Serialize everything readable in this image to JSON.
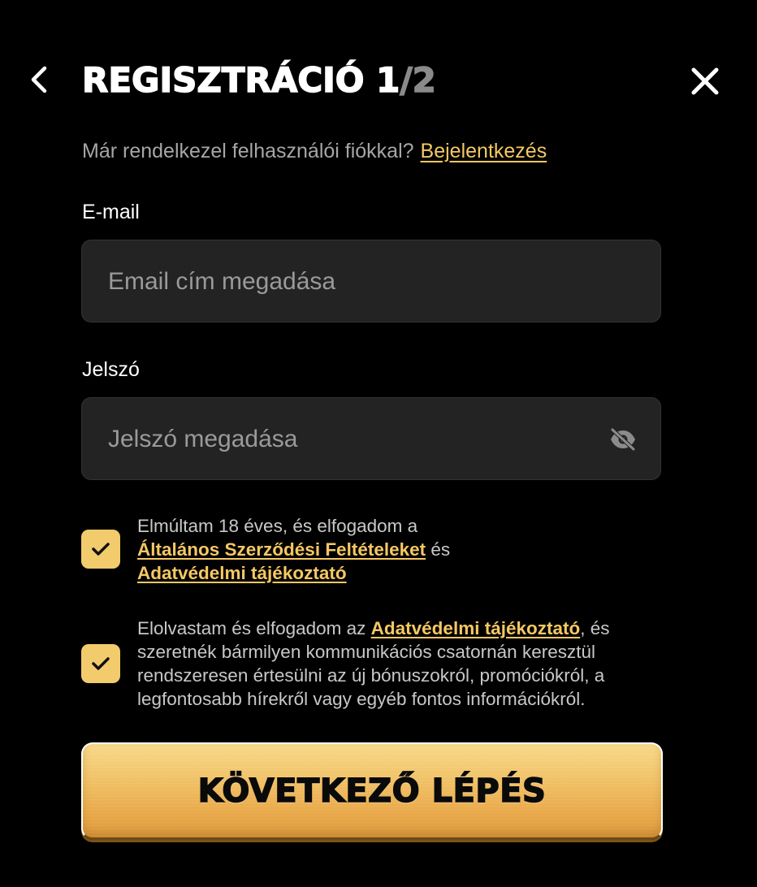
{
  "header": {
    "title_main": "REGISZTRÁCIÓ 1",
    "title_total": "/2",
    "back_icon": "chevron-left-icon",
    "close_icon": "close-icon"
  },
  "login_prompt": {
    "text": "Már rendelkezel felhasználói fiókkal?",
    "link": "Bejelentkezés"
  },
  "email": {
    "label": "E-mail",
    "placeholder": "Email cím megadása",
    "value": ""
  },
  "password": {
    "label": "Jelszó",
    "placeholder": "Jelszó megadása",
    "value": "",
    "toggle_icon": "eye-off-icon"
  },
  "consents": [
    {
      "checked": true,
      "text_1": "Elmúltam 18 éves, és elfogadom a",
      "link_1": "Általános Szerződési Feltételeket",
      "text_2": " és",
      "link_2": "Adatvédelmi tájékoztató"
    },
    {
      "checked": true,
      "text_1": "Elolvastam és elfogadom az ",
      "link_1": "Adatvédelmi tájékoztató",
      "text_2": ", és szeretnék bármilyen kommunikációs csatornán keresztül rendszeresen értesülni az új bónuszokról, promóciókról, a legfontosabb hírekről vagy egyéb fontos információkról."
    }
  ],
  "next_button": {
    "label": "KÖVETKEZŐ LÉPÉS"
  },
  "colors": {
    "background": "#000000",
    "accent": "#f5c862",
    "checkbox": "#f2cb6c",
    "input_bg": "#232323"
  }
}
